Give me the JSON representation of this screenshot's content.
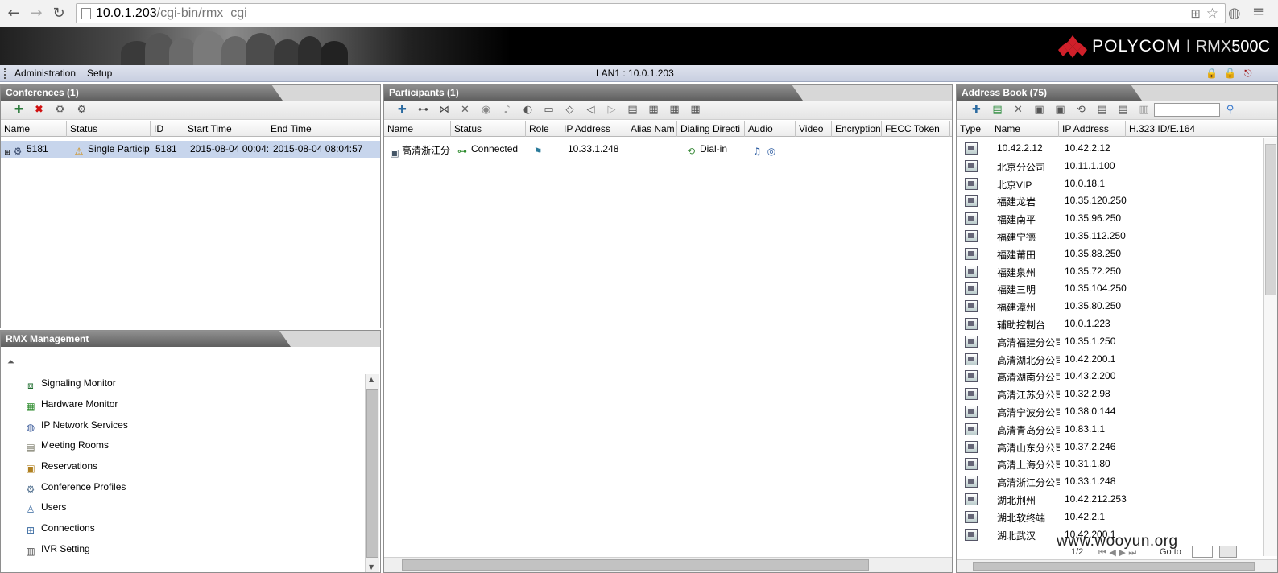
{
  "browser": {
    "url_host": "10.0.1.203",
    "url_path": "/cgi-bin/rmx_cgi"
  },
  "banner": {
    "brand": "POLYCOM",
    "separator": "I",
    "model_prefix": "RMX",
    "model_suffix": "500C"
  },
  "menu": {
    "items": [
      "Administration",
      "Setup"
    ],
    "lan_status": "LAN1 : 10.0.1.203"
  },
  "conferences": {
    "title": "Conferences (1)",
    "columns": [
      "Name",
      "Status",
      "ID",
      "Start Time",
      "End Time"
    ],
    "rows": [
      {
        "name": "5181",
        "status": "Single Particip",
        "id": "5181",
        "start": "2015-08-04 00:04:",
        "end": "2015-08-04 08:04:57"
      }
    ]
  },
  "participants": {
    "title": "Participants (1)",
    "columns": [
      "Name",
      "Status",
      "Role",
      "IP Address",
      "Alias Nam",
      "Dialing Directi",
      "Audio",
      "Video",
      "Encryption",
      "FECC Token"
    ],
    "rows": [
      {
        "name": "高清浙江分",
        "status": "Connected",
        "ip": "10.33.1.248",
        "dialing": "Dial-in"
      }
    ]
  },
  "management": {
    "title": "RMX Management",
    "items": [
      {
        "label": "Signaling Monitor",
        "icon": "signal-icon"
      },
      {
        "label": "Hardware Monitor",
        "icon": "hardware-icon"
      },
      {
        "label": "IP Network Services",
        "icon": "globe-icon"
      },
      {
        "label": "Meeting Rooms",
        "icon": "meeting-room-icon"
      },
      {
        "label": "Reservations",
        "icon": "calendar-icon"
      },
      {
        "label": "Conference Profiles",
        "icon": "profile-icon"
      },
      {
        "label": "Users",
        "icon": "user-icon"
      },
      {
        "label": "Connections",
        "icon": "network-icon"
      },
      {
        "label": "IVR Setting",
        "icon": "ivr-icon"
      }
    ]
  },
  "address_book": {
    "title": "Address Book (75)",
    "columns": [
      "Type",
      "Name",
      "IP Address",
      "H.323 ID/E.164"
    ],
    "rows": [
      {
        "name": "10.42.2.12",
        "ip": "10.42.2.12"
      },
      {
        "name": "北京分公司",
        "ip": "10.11.1.100"
      },
      {
        "name": "北京VIP",
        "ip": "10.0.18.1"
      },
      {
        "name": "福建龙岩",
        "ip": "10.35.120.250"
      },
      {
        "name": "福建南平",
        "ip": "10.35.96.250"
      },
      {
        "name": "福建宁德",
        "ip": "10.35.112.250"
      },
      {
        "name": "福建莆田",
        "ip": "10.35.88.250"
      },
      {
        "name": "福建泉州",
        "ip": "10.35.72.250"
      },
      {
        "name": "福建三明",
        "ip": "10.35.104.250"
      },
      {
        "name": "福建漳州",
        "ip": "10.35.80.250"
      },
      {
        "name": "辅助控制台",
        "ip": "10.0.1.223"
      },
      {
        "name": "高清福建分公司",
        "ip": "10.35.1.250"
      },
      {
        "name": "高清湖北分公司",
        "ip": "10.42.200.1"
      },
      {
        "name": "高清湖南分公司",
        "ip": "10.43.2.200"
      },
      {
        "name": "高清江苏分公司",
        "ip": "10.32.2.98"
      },
      {
        "name": "高清宁波分公司",
        "ip": "10.38.0.144"
      },
      {
        "name": "高清青岛分公司",
        "ip": "10.83.1.1"
      },
      {
        "name": "高清山东分公司",
        "ip": "10.37.2.246"
      },
      {
        "name": "高清上海分公司",
        "ip": "10.31.1.80"
      },
      {
        "name": "高清浙江分公司",
        "ip": "10.33.1.248"
      },
      {
        "name": "湖北荆州",
        "ip": "10.42.212.253"
      },
      {
        "name": "湖北软终端",
        "ip": "10.42.2.1"
      },
      {
        "name": "湖北武汉",
        "ip": "10.42.200.1"
      }
    ],
    "pager": "1/2",
    "goto_label": "Go to"
  },
  "watermark": "www.wooyun.org"
}
